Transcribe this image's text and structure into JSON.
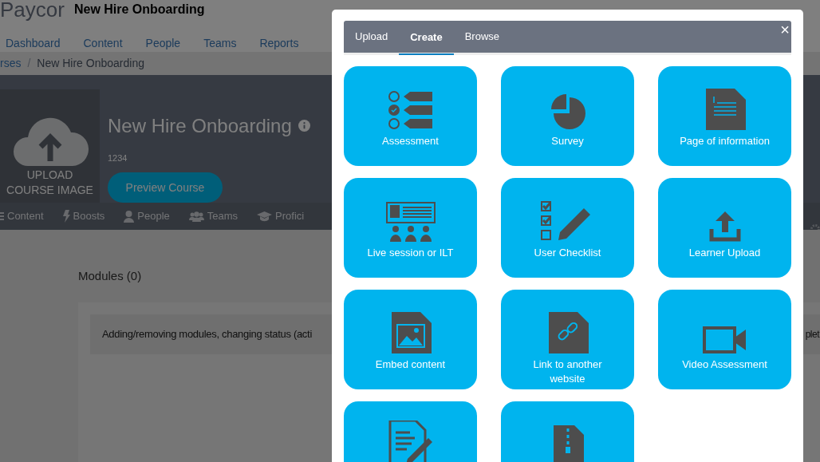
{
  "header": {
    "logo": "Paycor",
    "app_title": "New Hire Onboarding",
    "nav": [
      "Dashboard",
      "Content",
      "People",
      "Teams",
      "Reports"
    ]
  },
  "breadcrumb": {
    "parent": "rses",
    "separator": "/",
    "current": "New Hire Onboarding"
  },
  "course": {
    "image_label": "UPLOAD COURSE IMAGE",
    "title": "New Hire Onboarding",
    "code": "1234",
    "preview_button": "Preview Course"
  },
  "course_tabs": [
    {
      "label": "Content",
      "kind": "list"
    },
    {
      "label": "Boosts",
      "kind": "bolt"
    },
    {
      "label": "People",
      "kind": "person"
    },
    {
      "label": "Teams",
      "kind": "group"
    },
    {
      "label": "Profici",
      "kind": "cap"
    }
  ],
  "modules": {
    "heading": "Modules (0)",
    "notice": "Adding/removing modules, changing status (acti",
    "notice_tail": "plet"
  },
  "dialog": {
    "close": "×",
    "tabs": [
      {
        "label": "Upload",
        "selected": false
      },
      {
        "label": "Create",
        "selected": true
      },
      {
        "label": "Browse",
        "selected": false
      }
    ],
    "tiles": [
      {
        "kind": "assessment",
        "label": "Assessment"
      },
      {
        "kind": "survey",
        "label": "Survey"
      },
      {
        "kind": "page",
        "label": "Page of information"
      },
      {
        "kind": "live",
        "label": "Live session or ILT"
      },
      {
        "kind": "checklist",
        "label": "User Checklist"
      },
      {
        "kind": "upload",
        "label": "Learner Upload"
      },
      {
        "kind": "embed",
        "label": "Embed content"
      },
      {
        "kind": "link",
        "label": "Link to another website"
      },
      {
        "kind": "video",
        "label": "Video Assessment"
      },
      {
        "kind": "form"
      },
      {
        "kind": "zip"
      }
    ]
  }
}
